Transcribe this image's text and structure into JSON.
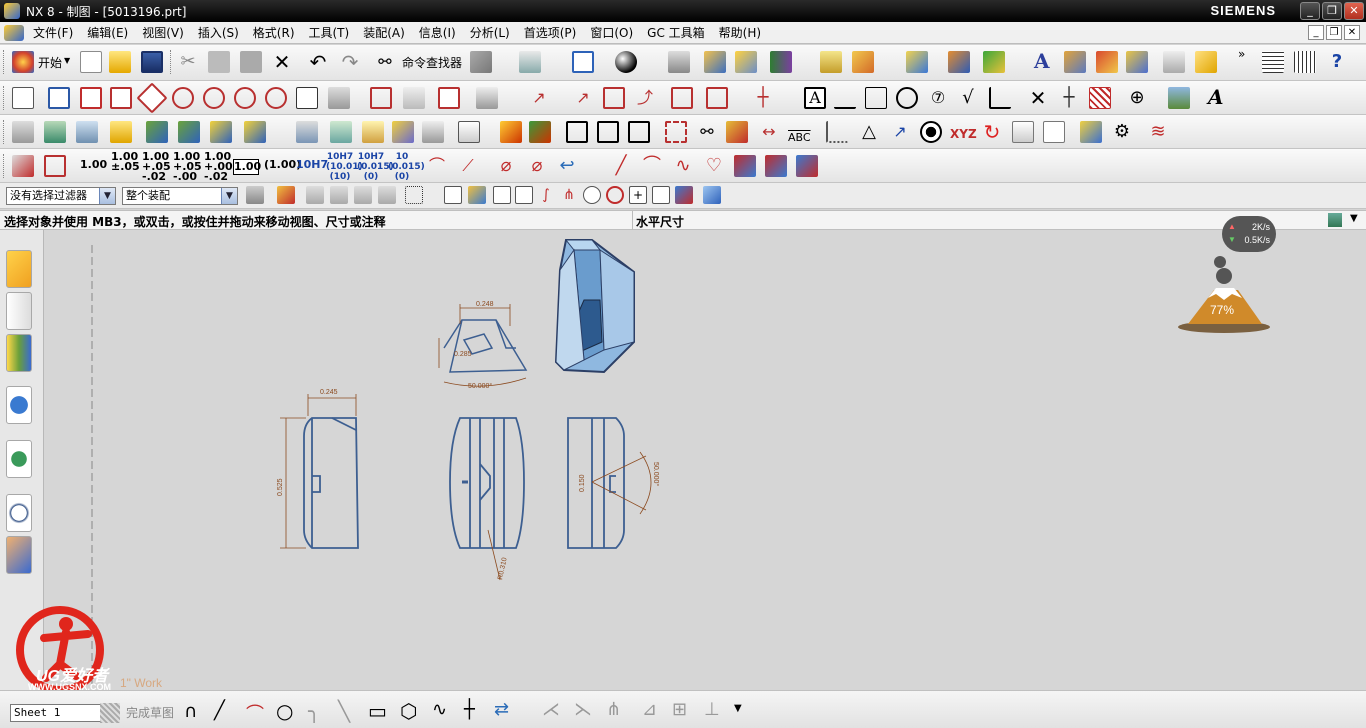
{
  "window": {
    "title": "NX 8 - 制图 - [5013196.prt]",
    "brand": "SIEMENS",
    "controls": [
      "_",
      "❐",
      "✕"
    ]
  },
  "menubar": {
    "items": [
      "文件(F)",
      "编辑(E)",
      "视图(V)",
      "插入(S)",
      "格式(R)",
      "工具(T)",
      "装配(A)",
      "信息(I)",
      "分析(L)",
      "首选项(P)",
      "窗口(O)",
      "GC 工具箱",
      "帮助(H)"
    ],
    "mdi_controls": [
      "_",
      "❐",
      "✕"
    ]
  },
  "toolbar": {
    "start_label": "开始",
    "command_finder_label": "命令查找器",
    "tolerance_labels": [
      "1.00",
      "1.00 ±.05",
      "1.00 +.05 -.02",
      "1.00 +.05 -.00",
      "1.00 +.00 -.02",
      "1.00",
      "(1.00)",
      "10H7",
      "10H7 (10.01) (10)",
      "10H7 (0.015) (0)",
      "10 (0.015) (0)"
    ],
    "abc_label": "ABC",
    "xyz_label": "XYZ",
    "text_a_label": "A"
  },
  "selection_bar": {
    "filter_value": "没有选择过滤器",
    "scope_value": "整个装配"
  },
  "status": {
    "prompt": "选择对象并使用 MB3，或双击，或按住并拖动来移动视图、尺寸或注释",
    "status_text": "水平尺寸"
  },
  "drawing": {
    "dims": [
      "0.248",
      "0.285",
      "50.000°",
      "0.245",
      "0.525",
      "R0.310",
      "0.150",
      "50.000°"
    ]
  },
  "network_monitor": {
    "up": "2K/s",
    "down": "0.5K/s",
    "percent": "77%"
  },
  "watermark": {
    "text": "UG爱好者",
    "url": "WWW.UGSNX.COM",
    "work_label": "1\" Work"
  },
  "bottombar": {
    "sheet_value": "Sheet 1",
    "finish_sketch_label": "完成草图"
  },
  "colors": {
    "geometry": "#3d5f91",
    "dimension": "#8b4a1f",
    "canvas": "#d6d6d6",
    "logo_red": "#e0261c"
  }
}
